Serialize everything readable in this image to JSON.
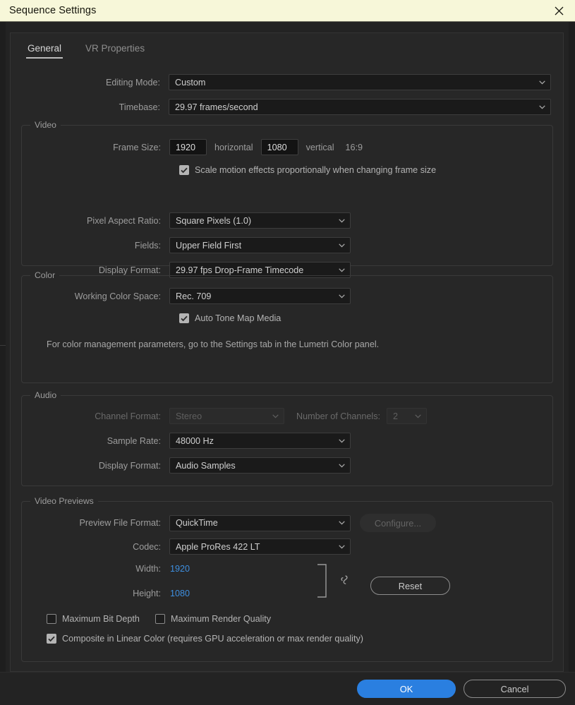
{
  "window": {
    "title": "Sequence Settings",
    "close_icon": "close-icon"
  },
  "tabs": [
    {
      "label": "General",
      "active": true
    },
    {
      "label": "VR Properties",
      "active": false
    }
  ],
  "top": {
    "editing_mode_label": "Editing Mode:",
    "editing_mode_value": "Custom",
    "timebase_label": "Timebase:",
    "timebase_value": "29.97  frames/second"
  },
  "video": {
    "legend": "Video",
    "frame_size_label": "Frame Size:",
    "frame_width": "1920",
    "horizontal_label": "horizontal",
    "frame_height": "1080",
    "vertical_label": "vertical",
    "aspect_label": "16:9",
    "scale_motion_label": "Scale motion effects proportionally when changing frame size",
    "scale_motion_checked": true,
    "pixel_aspect_label": "Pixel Aspect Ratio:",
    "pixel_aspect_value": "Square Pixels (1.0)",
    "fields_label": "Fields:",
    "fields_value": "Upper Field First",
    "display_format_label": "Display Format:",
    "display_format_value": "29.97 fps Drop-Frame Timecode"
  },
  "color": {
    "legend": "Color",
    "working_color_space_label": "Working Color Space:",
    "working_color_space_value": "Rec. 709",
    "auto_tone_map_label": "Auto Tone Map Media",
    "auto_tone_map_checked": true,
    "note": "For color management parameters, go to the Settings tab in the Lumetri Color panel."
  },
  "audio": {
    "legend": "Audio",
    "channel_format_label": "Channel Format:",
    "channel_format_value": "Stereo",
    "channel_format_disabled": true,
    "number_of_channels_label": "Number of Channels:",
    "number_of_channels_value": "2",
    "number_of_channels_disabled": true,
    "sample_rate_label": "Sample Rate:",
    "sample_rate_value": "48000 Hz",
    "display_format_label": "Display Format:",
    "display_format_value": "Audio Samples"
  },
  "video_previews": {
    "legend": "Video Previews",
    "preview_file_format_label": "Preview File Format:",
    "preview_file_format_value": "QuickTime",
    "configure_label": "Configure...",
    "configure_disabled": true,
    "codec_label": "Codec:",
    "codec_value": "Apple ProRes 422 LT",
    "width_label": "Width:",
    "width_value": "1920",
    "height_label": "Height:",
    "height_value": "1080",
    "link_icon": "chain-link-icon",
    "reset_label": "Reset",
    "max_bit_depth_label": "Maximum Bit Depth",
    "max_bit_depth_checked": false,
    "max_render_quality_label": "Maximum Render Quality",
    "max_render_quality_checked": false,
    "composite_linear_label": "Composite in Linear Color (requires GPU acceleration or max render quality)",
    "composite_linear_checked": true
  },
  "footer": {
    "ok_label": "OK",
    "cancel_label": "Cancel"
  },
  "colors": {
    "titlebar_bg": "#f7f7d9",
    "accent_blue": "#2a7fe0",
    "value_blue": "#3e8fe0",
    "panel_bg": "#272727"
  }
}
